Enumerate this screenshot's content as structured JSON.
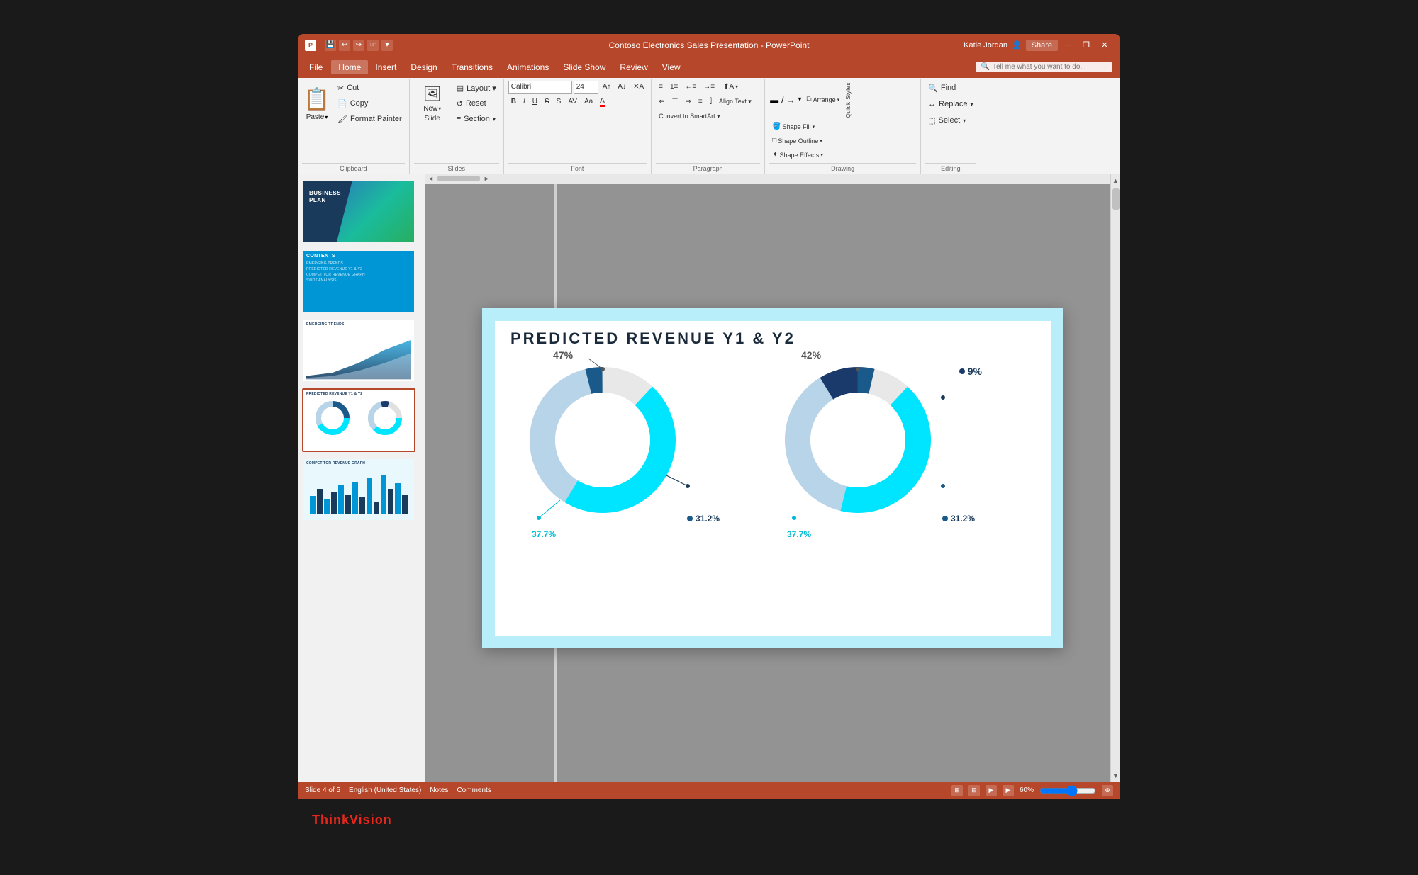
{
  "app": {
    "title": "Contoso Electronics Sales Presentation - PowerPoint",
    "icon": "P"
  },
  "titlebar": {
    "save_icon": "💾",
    "undo": "↩",
    "redo": "↪",
    "minimize": "─",
    "restore": "❐",
    "close": "✕",
    "user": "Katie Jordan",
    "share": "Share"
  },
  "menu": {
    "items": [
      "File",
      "Home",
      "Insert",
      "Design",
      "Transitions",
      "Animations",
      "Slide Show",
      "Review",
      "View"
    ]
  },
  "ribbon": {
    "clipboard": {
      "label": "Clipboard",
      "paste": "Paste",
      "cut": "✂ Cut",
      "copy": "Copy",
      "format_painter": "Format Painter"
    },
    "slides": {
      "label": "Slides",
      "new_slide": "New Slide",
      "layout": "Layout",
      "reset": "Reset",
      "section": "Section"
    },
    "font": {
      "label": "Font",
      "name": "Calibri",
      "size": "24",
      "bold": "B",
      "italic": "I",
      "underline": "U",
      "strikethrough": "S"
    },
    "paragraph": {
      "label": "Paragraph",
      "text_direction": "Text Direction",
      "align_text": "Align Text",
      "convert_smartart": "Convert to SmartArt"
    },
    "drawing": {
      "label": "Drawing",
      "arrange": "Arrange",
      "quick_styles": "Quick Styles",
      "shape_fill": "Shape Fill",
      "shape_outline": "Shape Outline",
      "shape_effects": "Shape Effects"
    },
    "editing": {
      "label": "Editing",
      "find": "Find",
      "replace": "Replace",
      "select": "Select"
    }
  },
  "slides": [
    {
      "id": 1,
      "type": "business_plan",
      "title": "BUSINESS PLAN",
      "subtitle": "",
      "active": false
    },
    {
      "id": 2,
      "type": "contents",
      "title": "CONTENTS",
      "items": [
        "EMERGING TRENDS",
        "PREDICTED REVENUE Y1 & Y2",
        "COMPETITOR REVENUE GRAPH",
        "SWOT ANALYSIS"
      ],
      "active": false
    },
    {
      "id": 3,
      "type": "emerging_trends",
      "title": "EMERGING TRENDS",
      "active": false
    },
    {
      "id": 4,
      "type": "revenue",
      "title": "PREDICTED REVENUE Y1 & Y2",
      "active": true
    },
    {
      "id": 5,
      "type": "competitor",
      "title": "COMPETITOR REVENUE GRAPH",
      "active": false
    }
  ],
  "main_slide": {
    "title": "PREDICTED REVENUE Y1 & Y2",
    "chart1": {
      "segments": [
        {
          "label": "47%",
          "value": 47,
          "color": "#00e5ff",
          "position": "top"
        },
        {
          "label": "37.7%",
          "value": 37.7,
          "color": "#b8d4e8",
          "position": "bottom-left"
        },
        {
          "label": "31.2%",
          "value": 31.2,
          "color": "#1a3a5c",
          "position": "bottom-right"
        }
      ]
    },
    "chart2": {
      "segments": [
        {
          "label": "42%",
          "value": 42,
          "color": "#00e5ff",
          "position": "top"
        },
        {
          "label": "9%",
          "value": 9,
          "color": "#1a3a6c",
          "position": "right"
        },
        {
          "label": "37.7%",
          "value": 37.7,
          "color": "#b8d4e8",
          "position": "bottom-left"
        },
        {
          "label": "31.2%",
          "value": 31.2,
          "color": "#1a3a5c",
          "position": "bottom-right"
        }
      ]
    }
  },
  "statusbar": {
    "slide_count": "Slide 4 of 5",
    "language": "English (United States)",
    "notes": "Notes",
    "comments": "Comments",
    "zoom": "60%"
  },
  "thinkvision": {
    "brand": "ThinkVision"
  },
  "searchbar": {
    "placeholder": "Tell me what you want to do..."
  }
}
